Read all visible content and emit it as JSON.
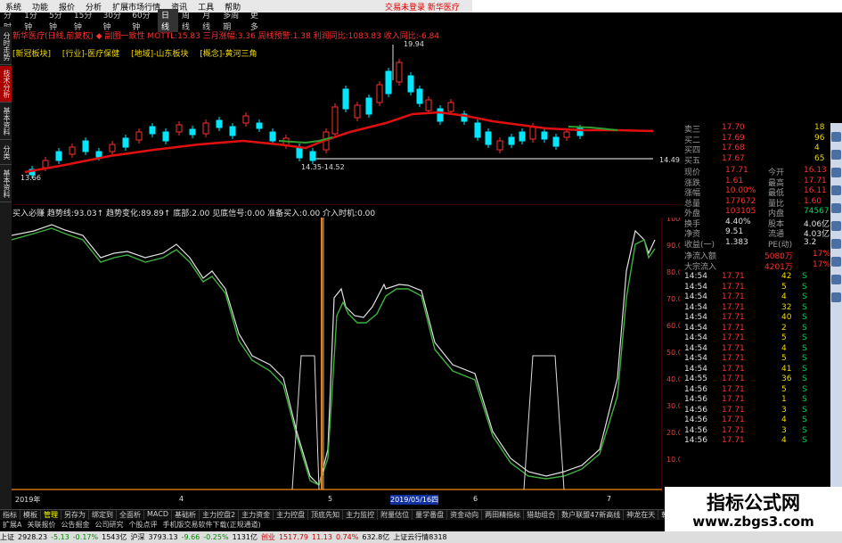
{
  "menu": [
    "系统",
    "功能",
    "报价",
    "分析",
    "扩展市场行情",
    "资讯",
    "工具",
    "帮助"
  ],
  "alert_text": "交易未登录 新华医疗",
  "periods": [
    "分时",
    "1分钟",
    "5分钟",
    "15分钟",
    "30分钟",
    "60分钟",
    "日线",
    "周线",
    "月线",
    "多周期",
    "更多"
  ],
  "active_period": "日线",
  "info_line": "新华医疗(日线,前复权) ◆ 副图一致性 MOTTL:15.83 三月涨幅:3.36 周线预警:1.38 利润同比:1083.83 收入同比:-6.84",
  "tags": [
    "[新冠板块]",
    "[行业]-医疗保健",
    "[地域]-山东板块",
    "[概念]-黄河三角"
  ],
  "left_tabs": [
    "分时走势",
    "技术分析",
    "基本资料",
    "分类",
    "基本资料"
  ],
  "price_labels": {
    "high": "19.94",
    "low_left": "13.66",
    "low_mid": "14.35-14.52",
    "right_axis": "14.49"
  },
  "sub_info": "买入必赚 趋势线:93.03↑ 趋势变化:89.89↑ 底部:2.00 见底信号:0.00 准备买入:0.00 介入时机:0.00",
  "sub_axis": [
    "100.0",
    "90.00",
    "80.00",
    "70.00",
    "60.00",
    "50.00",
    "40.00",
    "30.00",
    "20.00",
    "10.00"
  ],
  "date_axis": [
    "2019年",
    "4",
    "5",
    "2019/05/16四",
    "6",
    "7"
  ],
  "quote": {
    "orders": [
      {
        "label": "卖三",
        "price": "17.70",
        "vol": "18"
      },
      {
        "label": "买二",
        "price": "17.69",
        "vol": "96"
      },
      {
        "label": "买四",
        "price": "17.68",
        "vol": "4"
      },
      {
        "label": "买五",
        "price": "17.67",
        "vol": "65"
      }
    ],
    "stats": [
      {
        "l": "现价",
        "v": "17.71",
        "l2": "今开",
        "v2": "16.13"
      },
      {
        "l": "涨跌",
        "v": "1.61",
        "l2": "最高",
        "v2": "17.71"
      },
      {
        "l": "涨幅",
        "v": "10.00%",
        "l2": "最低",
        "v2": "16.11"
      },
      {
        "l": "总量",
        "v": "177672",
        "l2": "量比",
        "v2": "1.60"
      },
      {
        "l": "外盘",
        "v": "103105",
        "l2": "内盘",
        "v2": "74567"
      },
      {
        "l": "换手",
        "v": "4.40%",
        "l2": "股本",
        "v2": "4.06亿"
      },
      {
        "l": "净资",
        "v": "9.51",
        "l2": "流通",
        "v2": "4.03亿"
      },
      {
        "l": "收益(一)",
        "v": "1.383",
        "l2": "PE(动)",
        "v2": "3.2"
      }
    ],
    "flows": [
      {
        "l": "净流入额",
        "v": "5080万",
        "r": "17%"
      },
      {
        "l": "大宗流入",
        "v": "4201万",
        "r": "17%"
      }
    ],
    "ticks": [
      {
        "t": "14:54",
        "p": "17.71",
        "v": "42",
        "s": "S"
      },
      {
        "t": "14:54",
        "p": "17.71",
        "v": "5",
        "s": "S"
      },
      {
        "t": "14:54",
        "p": "17.71",
        "v": "4",
        "s": "S"
      },
      {
        "t": "14:54",
        "p": "17.71",
        "v": "32",
        "s": "S"
      },
      {
        "t": "14:54",
        "p": "17.71",
        "v": "40",
        "s": "S"
      },
      {
        "t": "14:54",
        "p": "17.71",
        "v": "2",
        "s": "S"
      },
      {
        "t": "14:54",
        "p": "17.71",
        "v": "5",
        "s": "S"
      },
      {
        "t": "14:54",
        "p": "17.71",
        "v": "4",
        "s": "S"
      },
      {
        "t": "14:54",
        "p": "17.71",
        "v": "5",
        "s": "S"
      },
      {
        "t": "14:54",
        "p": "17.71",
        "v": "41",
        "s": "S"
      },
      {
        "t": "14:55",
        "p": "17.71",
        "v": "36",
        "s": "S"
      },
      {
        "t": "14:56",
        "p": "17.71",
        "v": "5",
        "s": "S"
      },
      {
        "t": "14:56",
        "p": "17.71",
        "v": "1",
        "s": "S"
      },
      {
        "t": "14:56",
        "p": "17.71",
        "v": "3",
        "s": "S"
      },
      {
        "t": "14:56",
        "p": "17.71",
        "v": "4",
        "s": "S"
      },
      {
        "t": "14:56",
        "p": "17.71",
        "v": "3",
        "s": "S"
      },
      {
        "t": "14:56",
        "p": "17.71",
        "v": "4",
        "s": "S"
      }
    ]
  },
  "bottom_tabs": [
    "指标",
    "模板",
    "管理",
    "另存为",
    "绑定到",
    "全面析",
    "MACD",
    "基础析",
    "主力控盘2",
    "主力资金",
    "主力控盘",
    "顶底先知",
    "主力监控",
    "附量估位",
    "量学番盘",
    "资金动向",
    "两田精指标",
    "猎劫组合",
    "数户联盟47新高线",
    "神龙在天",
    "乾坤量王",
    "缓慢涨停破解"
  ],
  "active_bottom_tab": "管理",
  "bottom_tabs2": [
    "扩展A",
    "关联报价",
    "公告掘金",
    "公司研究",
    "个股点评",
    "手机版交易软件下载(正规通道)"
  ],
  "status": [
    "上证",
    "2928.23",
    "-5.13",
    "-0.17%",
    "1543亿",
    "沪深",
    "3793.13",
    "-9.66",
    "-0.25%",
    "1131亿",
    "创业",
    "1517.79",
    "11.13",
    "0.74%",
    "632.8亿",
    "上证云行情8318"
  ],
  "watermark": {
    "line1": "指标公式网",
    "line2": "www.zbgs3.com"
  }
}
